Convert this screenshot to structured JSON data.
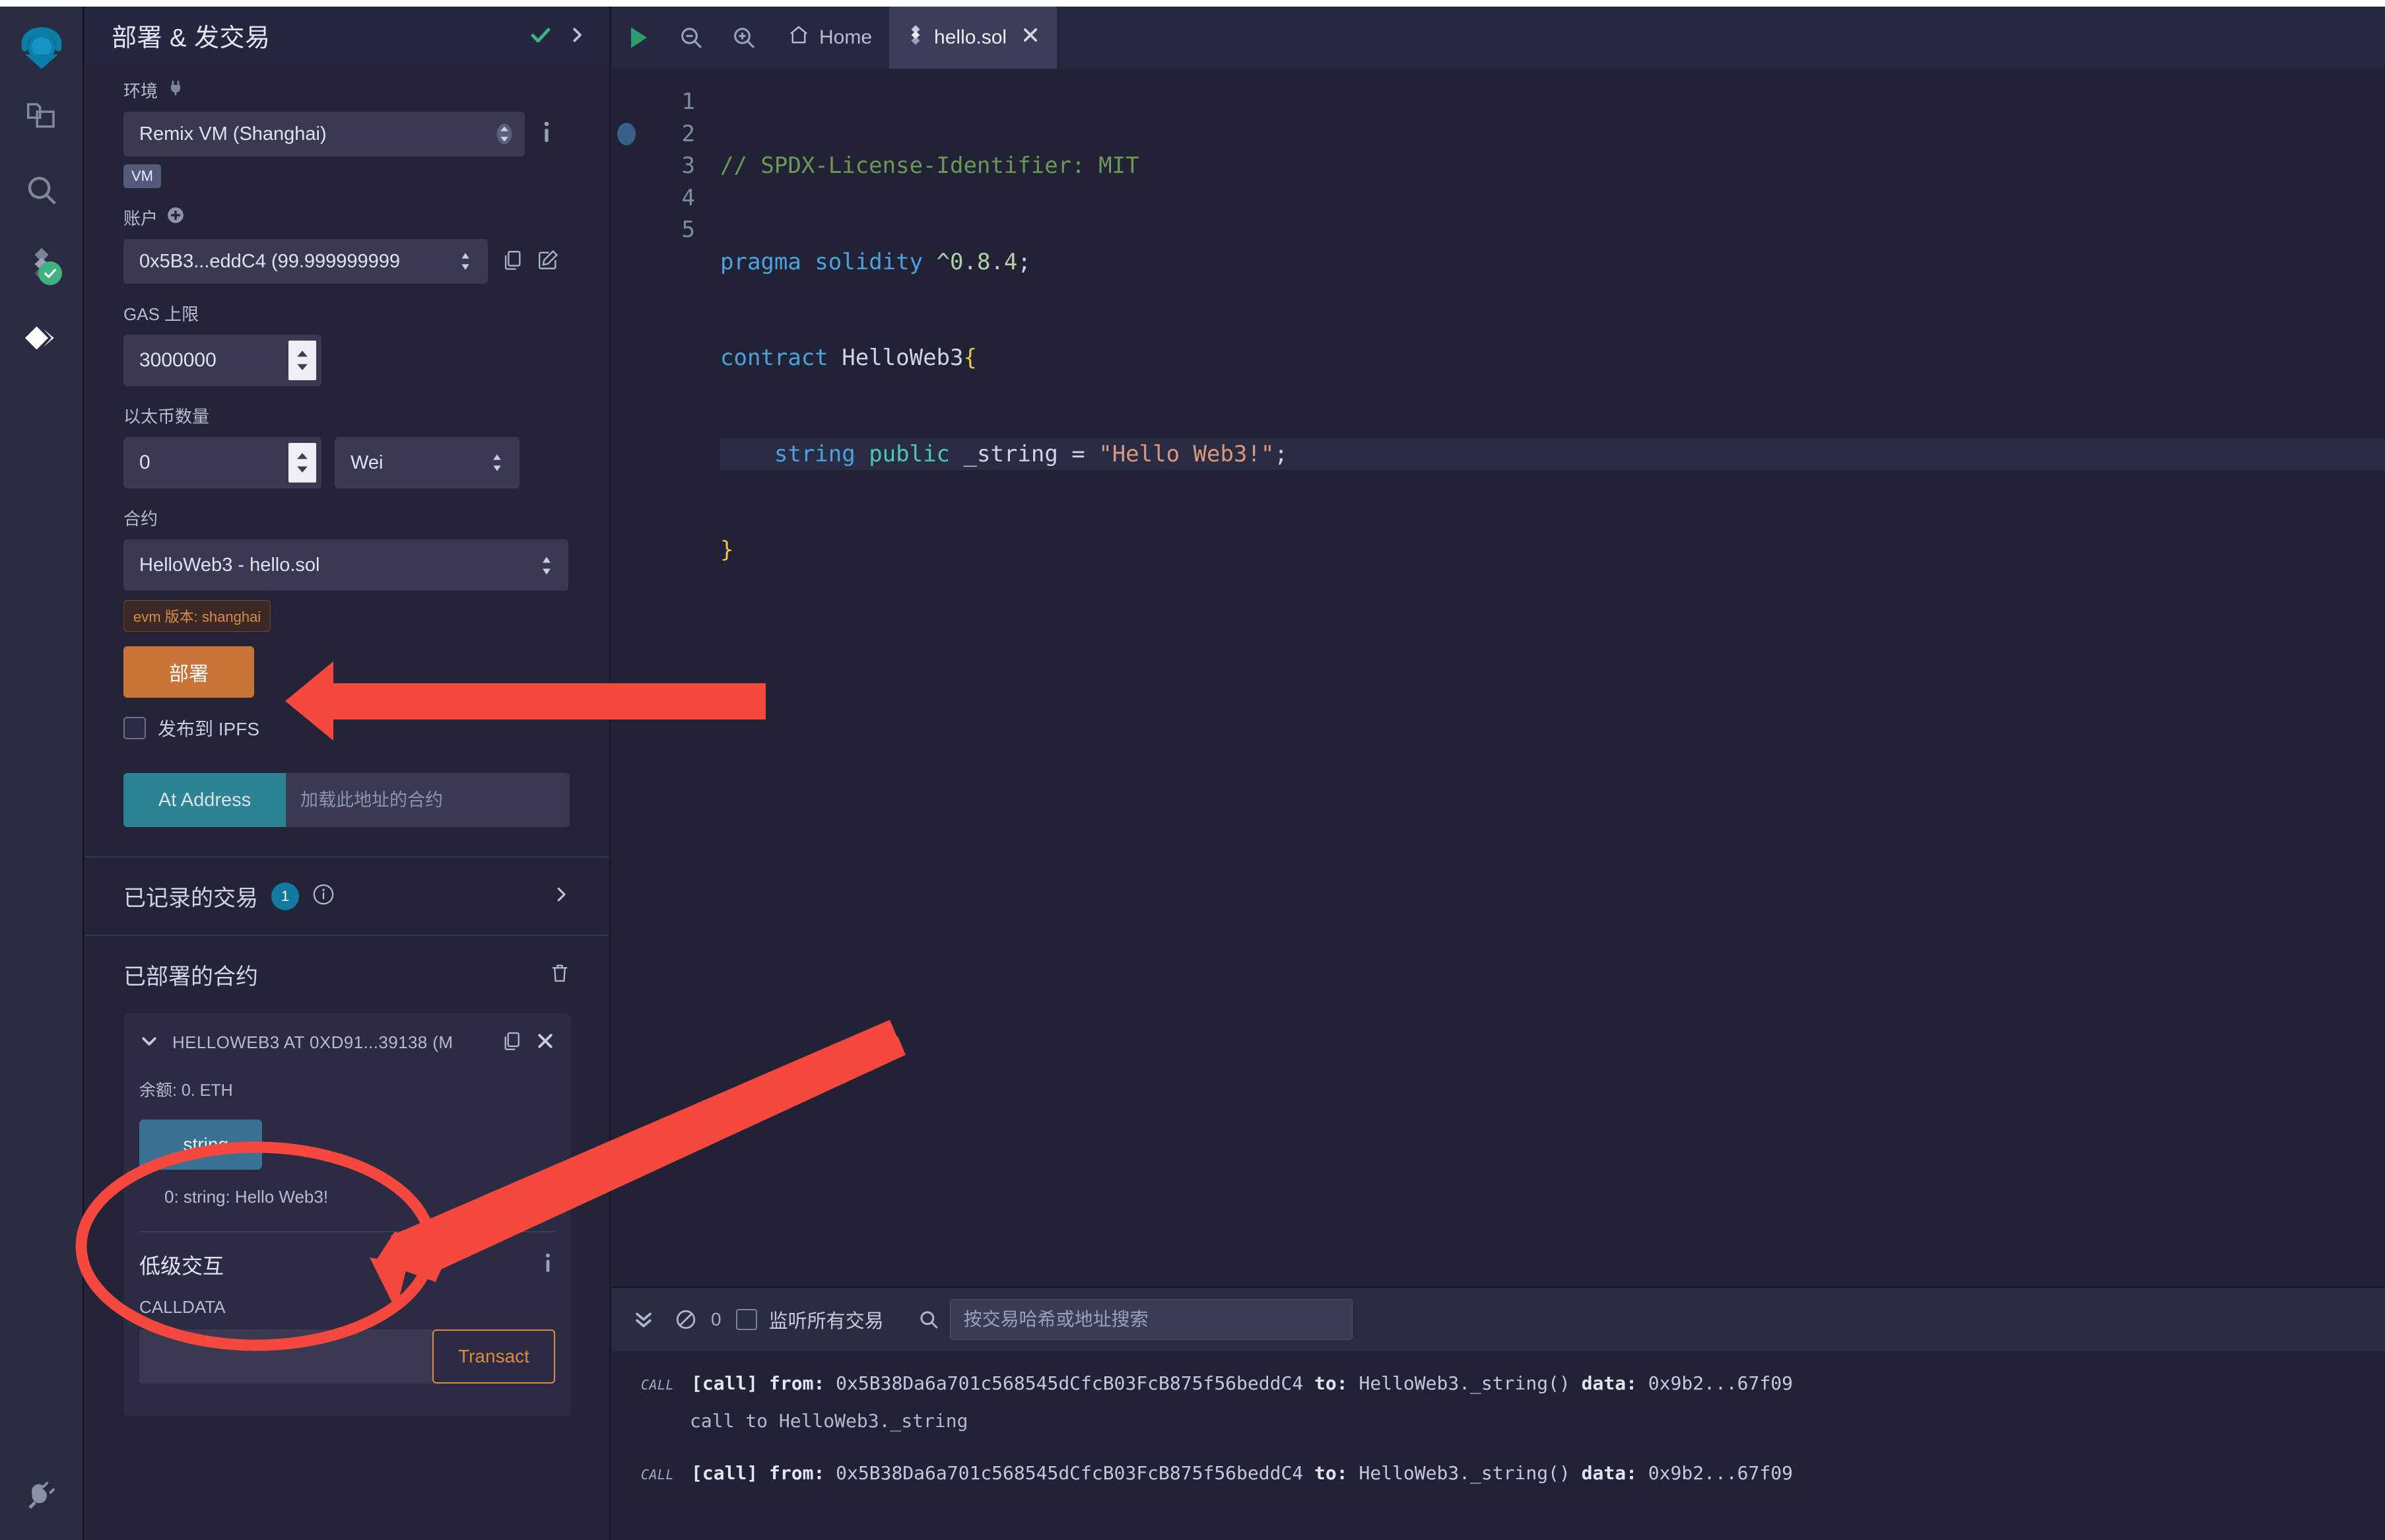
{
  "app": {
    "theme_bg": "#222236",
    "accent_orange": "#c87337",
    "accent_teal": "#2d8296",
    "accent_blue": "#3b7193"
  },
  "icon_sidebar": {
    "items": [
      {
        "name": "remix-logo",
        "label": "Remix"
      },
      {
        "name": "file-explorer-icon",
        "label": "文件资源管理器"
      },
      {
        "name": "search-icon",
        "label": "搜索"
      },
      {
        "name": "solidity-compiler-icon",
        "label": "Solidity 编译器"
      },
      {
        "name": "deploy-run-icon",
        "label": "部署 & 发交易"
      }
    ],
    "bottom": {
      "name": "plugin-manager-icon",
      "label": "插件管理器"
    }
  },
  "left_panel": {
    "title": "部署 & 发交易",
    "environment": {
      "label": "环境",
      "value": "Remix VM (Shanghai)",
      "badge": "VM"
    },
    "account": {
      "label": "账户",
      "value": "0x5B3...eddC4 (99.999999999"
    },
    "gas_limit": {
      "label": "GAS 上限",
      "value": "3000000"
    },
    "value_field": {
      "label": "以太币数量",
      "value": "0",
      "unit": "Wei"
    },
    "contract": {
      "label": "合约",
      "value": "HelloWeb3 - hello.sol",
      "evm_badge": "evm 版本: shanghai"
    },
    "deploy_button": "部署",
    "publish_ipfs": "发布到 IPFS",
    "at_address": {
      "button": "At Address",
      "placeholder": "加载此地址的合约"
    },
    "recorded_transactions": {
      "title": "已记录的交易",
      "count": "1"
    },
    "deployed_contracts": {
      "title": "已部署的合约",
      "instance": {
        "title": "HELLOWEB3 AT 0XD91...39138 (M",
        "balance": "余额: 0. ETH",
        "function_button": "_string",
        "result": "0: string: Hello Web3!"
      },
      "low_level": {
        "title": "低级交互",
        "calldata_label": "CALLDATA",
        "calldata_value": "",
        "transact_button": "Transact"
      }
    }
  },
  "editor": {
    "toolbar": {
      "run_label": "运行",
      "zoom_out_label": "缩小",
      "zoom_in_label": "放大"
    },
    "tabs": [
      {
        "label": "Home",
        "icon": "home-icon",
        "active": false,
        "closable": false
      },
      {
        "label": "hello.sol",
        "icon": "solidity-file-icon",
        "active": true,
        "closable": true
      }
    ],
    "line_numbers": [
      "1",
      "2",
      "3",
      "4",
      "5"
    ],
    "code_lines": [
      "// SPDX-License-Identifier: MIT",
      "pragma solidity ^0.8.4;",
      "contract HelloWeb3{",
      "    string public _string = \"Hello Web3!\";",
      "}"
    ]
  },
  "terminal": {
    "toolbar": {
      "error_count": "0",
      "listen_label": "监听所有交易",
      "search_placeholder": "按交易哈希或地址搜索",
      "search_value": ""
    },
    "entries": [
      {
        "tag": "CALL",
        "prefix": "[call]",
        "from_label": "from:",
        "from": "0x5B38Da6a701c568545dCfcB03FcB875f56beddC4",
        "to_label": "to:",
        "to": "HelloWeb3._string()",
        "data_label": "data:",
        "data": "0x9b2...67f09",
        "sub": "call to HelloWeb3._string"
      },
      {
        "tag": "CALL",
        "prefix": "[call]",
        "from_label": "from:",
        "from": "0x5B38Da6a701c568545dCfcB03FcB875f56beddC4",
        "to_label": "to:",
        "to": "HelloWeb3._string()",
        "data_label": "data:",
        "data": "0x9b2...67f09",
        "sub": ""
      }
    ]
  },
  "annotations": {
    "color": "#f6483c",
    "arrow_to_deploy": "指向部署按钮",
    "arrow_to_result": "指向 _string 结果",
    "ellipse_around_result": "圈出 _string 与返回值"
  }
}
